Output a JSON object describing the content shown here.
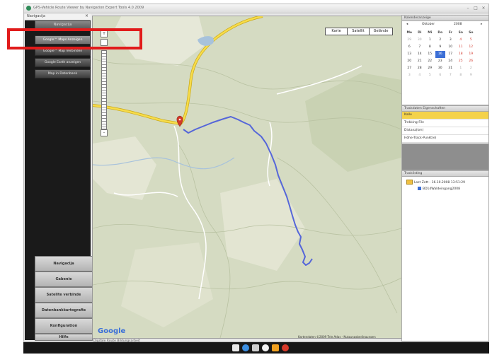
{
  "window": {
    "title": "GPS-Vehicle Route Viewer by Navigation Expert Tools 4.0 2009",
    "minimize": "–",
    "maximize": "□",
    "close": "×"
  },
  "sidebar": {
    "header_label": "Navigacija",
    "header_close": "×",
    "top_label": "Navigacija",
    "items": [
      {
        "label": "Google™ Maps Anzeigen"
      },
      {
        "label": "Google™ Map Verbinden"
      },
      {
        "label": "Google Earth anzeigen"
      },
      {
        "label": "Map in Datenbank"
      }
    ],
    "bottom_buttons": [
      {
        "label": "Navigacija"
      },
      {
        "label": "Gabenie"
      },
      {
        "label": "Satelite verbinde"
      },
      {
        "label": "Datenbankkartografie"
      },
      {
        "label": "Konfiguration"
      },
      {
        "label": "Hilfe"
      }
    ]
  },
  "map": {
    "type_buttons": [
      {
        "label": "Karte"
      },
      {
        "label": "Satellit"
      },
      {
        "label": "Gelände"
      }
    ],
    "zoom_in": "+",
    "zoom_out": "–",
    "logo": "Google",
    "copyright": "Kartendaten ©2009 Tele Atlas - Nutzungsbedingungen",
    "status_text": "Digitale Route Bildungsarbeit"
  },
  "calendar": {
    "panel_title": "Kalenderanzeige",
    "month": "Oktober",
    "year": "2008",
    "prev": "◂",
    "next": "▸",
    "weekdays": [
      "Mo",
      "Di",
      "Mi",
      "Do",
      "Fr",
      "Sa",
      "So"
    ],
    "weeks": [
      [
        "29",
        "30",
        "1",
        "2",
        "3",
        "4",
        "5"
      ],
      [
        "6",
        "7",
        "8",
        "9",
        "10",
        "11",
        "12"
      ],
      [
        "13",
        "14",
        "15",
        "16",
        "17",
        "18",
        "19"
      ],
      [
        "20",
        "21",
        "22",
        "23",
        "24",
        "25",
        "26"
      ],
      [
        "27",
        "28",
        "29",
        "30",
        "31",
        "1",
        "2"
      ],
      [
        "3",
        "4",
        "5",
        "6",
        "7",
        "8",
        "9"
      ]
    ],
    "today_index": [
      2,
      3
    ]
  },
  "properties": {
    "panel_title": "Trackdaten Eigenschaften",
    "rows": [
      {
        "label": "Kalle"
      },
      {
        "label": "Trekking-File"
      },
      {
        "label": "Distanz(km)"
      },
      {
        "label": "Höhe-Track-Punkt(e)"
      }
    ]
  },
  "tracks": {
    "panel_title": "Tracklisting",
    "folder_label": "Lost Zett - 16.10.2008 13:51:29",
    "track_label": "BD14Waldeingang2008"
  },
  "colors": {
    "route": "#5566d9",
    "highlight": "#e11b1b",
    "calendar_selected": "#3c6fd6",
    "property_selected": "#f4d24a"
  }
}
